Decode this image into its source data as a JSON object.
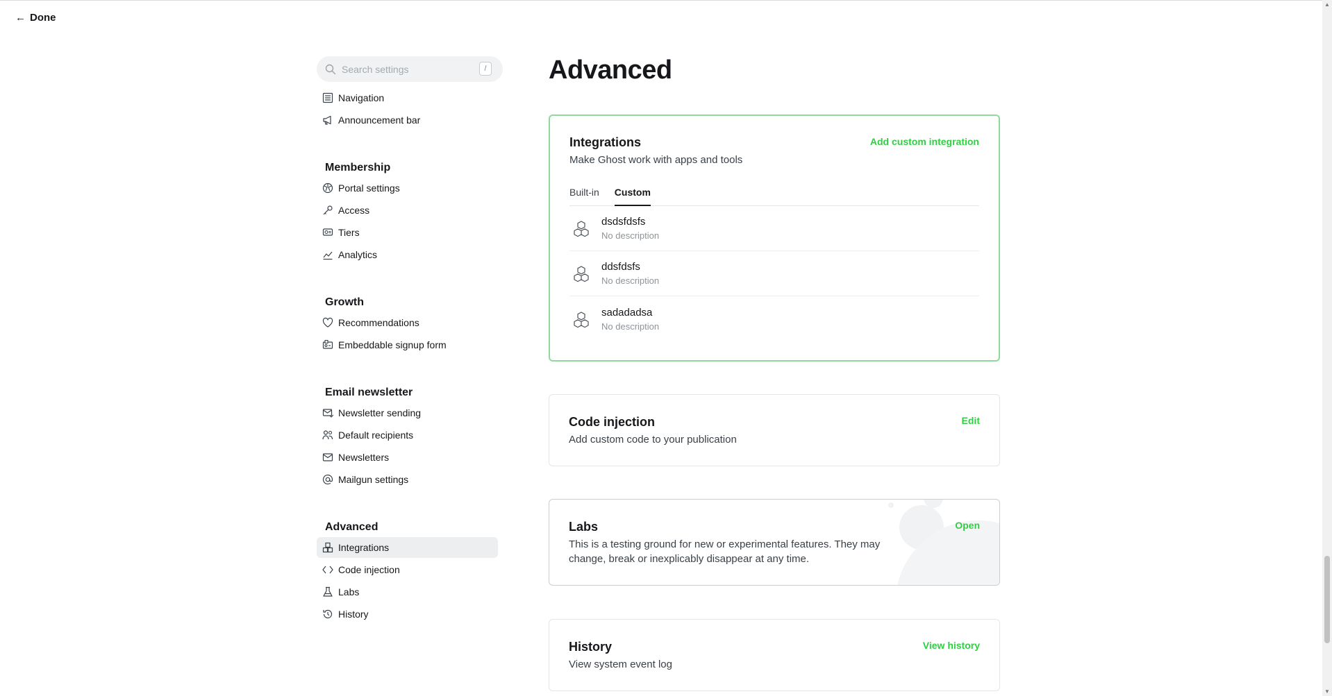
{
  "header": {
    "done_label": "Done"
  },
  "search": {
    "placeholder": "Search settings",
    "shortcut": "/"
  },
  "sidebar": {
    "top_items": [
      {
        "label": "Navigation",
        "icon": "list-icon"
      },
      {
        "label": "Announcement bar",
        "icon": "megaphone-icon"
      }
    ],
    "groups": [
      {
        "title": "Membership",
        "items": [
          {
            "label": "Portal settings",
            "icon": "portal-icon"
          },
          {
            "label": "Access",
            "icon": "key-icon"
          },
          {
            "label": "Tiers",
            "icon": "tiers-icon"
          },
          {
            "label": "Analytics",
            "icon": "chart-icon"
          }
        ]
      },
      {
        "title": "Growth",
        "items": [
          {
            "label": "Recommendations",
            "icon": "heart-icon"
          },
          {
            "label": "Embeddable signup form",
            "icon": "signup-form-icon"
          }
        ]
      },
      {
        "title": "Email newsletter",
        "items": [
          {
            "label": "Newsletter sending",
            "icon": "mail-send-icon"
          },
          {
            "label": "Default recipients",
            "icon": "users-icon"
          },
          {
            "label": "Newsletters",
            "icon": "envelope-icon"
          },
          {
            "label": "Mailgun settings",
            "icon": "at-icon"
          }
        ]
      },
      {
        "title": "Advanced",
        "items": [
          {
            "label": "Integrations",
            "icon": "integrations-icon",
            "active": true
          },
          {
            "label": "Code injection",
            "icon": "code-icon"
          },
          {
            "label": "Labs",
            "icon": "flask-icon"
          },
          {
            "label": "History",
            "icon": "history-icon"
          }
        ]
      }
    ]
  },
  "main": {
    "title": "Advanced",
    "integrations": {
      "title": "Integrations",
      "description": "Make Ghost work with apps and tools",
      "action": "Add custom integration",
      "tabs": [
        "Built-in",
        "Custom"
      ],
      "active_tab": "Custom",
      "items": [
        {
          "name": "dsdsfdsfs",
          "description": "No description"
        },
        {
          "name": "ddsfdsfs",
          "description": "No description"
        },
        {
          "name": "sadadadsa",
          "description": "No description"
        }
      ]
    },
    "code_injection": {
      "title": "Code injection",
      "description": "Add custom code to your publication",
      "action": "Edit"
    },
    "labs": {
      "title": "Labs",
      "description": "This is a testing ground for new or experimental features. They may change, break or inexplicably disappear at any time.",
      "action": "Open"
    },
    "history": {
      "title": "History",
      "description": "View system event log",
      "action": "View history"
    }
  },
  "colors": {
    "accent": "#30cf43",
    "highlight_border": "#8fd99a",
    "text": "#15171a"
  }
}
